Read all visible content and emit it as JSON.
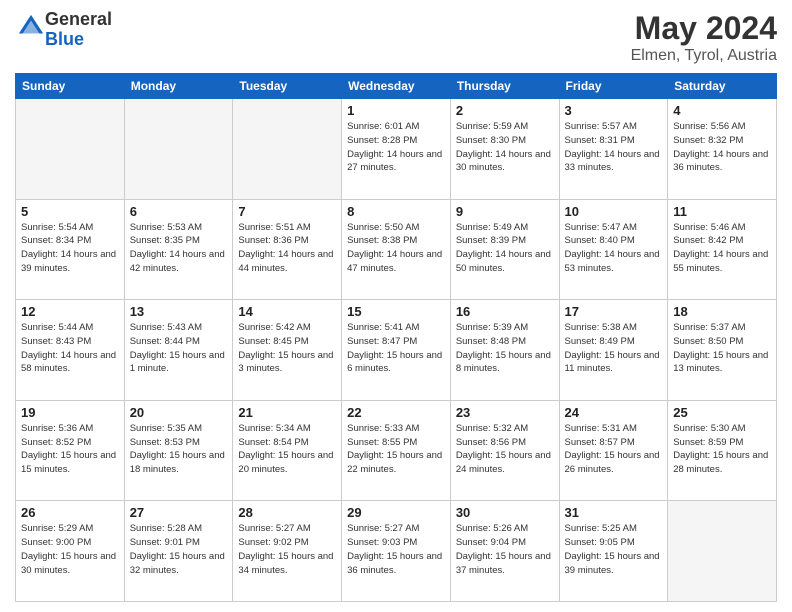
{
  "logo": {
    "general": "General",
    "blue": "Blue"
  },
  "title": "May 2024",
  "subtitle": "Elmen, Tyrol, Austria",
  "days_header": [
    "Sunday",
    "Monday",
    "Tuesday",
    "Wednesday",
    "Thursday",
    "Friday",
    "Saturday"
  ],
  "weeks": [
    [
      {
        "day": "",
        "empty": true
      },
      {
        "day": "",
        "empty": true
      },
      {
        "day": "",
        "empty": true
      },
      {
        "day": "1",
        "sunrise": "Sunrise: 6:01 AM",
        "sunset": "Sunset: 8:28 PM",
        "daylight": "Daylight: 14 hours and 27 minutes."
      },
      {
        "day": "2",
        "sunrise": "Sunrise: 5:59 AM",
        "sunset": "Sunset: 8:30 PM",
        "daylight": "Daylight: 14 hours and 30 minutes."
      },
      {
        "day": "3",
        "sunrise": "Sunrise: 5:57 AM",
        "sunset": "Sunset: 8:31 PM",
        "daylight": "Daylight: 14 hours and 33 minutes."
      },
      {
        "day": "4",
        "sunrise": "Sunrise: 5:56 AM",
        "sunset": "Sunset: 8:32 PM",
        "daylight": "Daylight: 14 hours and 36 minutes."
      }
    ],
    [
      {
        "day": "5",
        "sunrise": "Sunrise: 5:54 AM",
        "sunset": "Sunset: 8:34 PM",
        "daylight": "Daylight: 14 hours and 39 minutes."
      },
      {
        "day": "6",
        "sunrise": "Sunrise: 5:53 AM",
        "sunset": "Sunset: 8:35 PM",
        "daylight": "Daylight: 14 hours and 42 minutes."
      },
      {
        "day": "7",
        "sunrise": "Sunrise: 5:51 AM",
        "sunset": "Sunset: 8:36 PM",
        "daylight": "Daylight: 14 hours and 44 minutes."
      },
      {
        "day": "8",
        "sunrise": "Sunrise: 5:50 AM",
        "sunset": "Sunset: 8:38 PM",
        "daylight": "Daylight: 14 hours and 47 minutes."
      },
      {
        "day": "9",
        "sunrise": "Sunrise: 5:49 AM",
        "sunset": "Sunset: 8:39 PM",
        "daylight": "Daylight: 14 hours and 50 minutes."
      },
      {
        "day": "10",
        "sunrise": "Sunrise: 5:47 AM",
        "sunset": "Sunset: 8:40 PM",
        "daylight": "Daylight: 14 hours and 53 minutes."
      },
      {
        "day": "11",
        "sunrise": "Sunrise: 5:46 AM",
        "sunset": "Sunset: 8:42 PM",
        "daylight": "Daylight: 14 hours and 55 minutes."
      }
    ],
    [
      {
        "day": "12",
        "sunrise": "Sunrise: 5:44 AM",
        "sunset": "Sunset: 8:43 PM",
        "daylight": "Daylight: 14 hours and 58 minutes."
      },
      {
        "day": "13",
        "sunrise": "Sunrise: 5:43 AM",
        "sunset": "Sunset: 8:44 PM",
        "daylight": "Daylight: 15 hours and 1 minute."
      },
      {
        "day": "14",
        "sunrise": "Sunrise: 5:42 AM",
        "sunset": "Sunset: 8:45 PM",
        "daylight": "Daylight: 15 hours and 3 minutes."
      },
      {
        "day": "15",
        "sunrise": "Sunrise: 5:41 AM",
        "sunset": "Sunset: 8:47 PM",
        "daylight": "Daylight: 15 hours and 6 minutes."
      },
      {
        "day": "16",
        "sunrise": "Sunrise: 5:39 AM",
        "sunset": "Sunset: 8:48 PM",
        "daylight": "Daylight: 15 hours and 8 minutes."
      },
      {
        "day": "17",
        "sunrise": "Sunrise: 5:38 AM",
        "sunset": "Sunset: 8:49 PM",
        "daylight": "Daylight: 15 hours and 11 minutes."
      },
      {
        "day": "18",
        "sunrise": "Sunrise: 5:37 AM",
        "sunset": "Sunset: 8:50 PM",
        "daylight": "Daylight: 15 hours and 13 minutes."
      }
    ],
    [
      {
        "day": "19",
        "sunrise": "Sunrise: 5:36 AM",
        "sunset": "Sunset: 8:52 PM",
        "daylight": "Daylight: 15 hours and 15 minutes."
      },
      {
        "day": "20",
        "sunrise": "Sunrise: 5:35 AM",
        "sunset": "Sunset: 8:53 PM",
        "daylight": "Daylight: 15 hours and 18 minutes."
      },
      {
        "day": "21",
        "sunrise": "Sunrise: 5:34 AM",
        "sunset": "Sunset: 8:54 PM",
        "daylight": "Daylight: 15 hours and 20 minutes."
      },
      {
        "day": "22",
        "sunrise": "Sunrise: 5:33 AM",
        "sunset": "Sunset: 8:55 PM",
        "daylight": "Daylight: 15 hours and 22 minutes."
      },
      {
        "day": "23",
        "sunrise": "Sunrise: 5:32 AM",
        "sunset": "Sunset: 8:56 PM",
        "daylight": "Daylight: 15 hours and 24 minutes."
      },
      {
        "day": "24",
        "sunrise": "Sunrise: 5:31 AM",
        "sunset": "Sunset: 8:57 PM",
        "daylight": "Daylight: 15 hours and 26 minutes."
      },
      {
        "day": "25",
        "sunrise": "Sunrise: 5:30 AM",
        "sunset": "Sunset: 8:59 PM",
        "daylight": "Daylight: 15 hours and 28 minutes."
      }
    ],
    [
      {
        "day": "26",
        "sunrise": "Sunrise: 5:29 AM",
        "sunset": "Sunset: 9:00 PM",
        "daylight": "Daylight: 15 hours and 30 minutes."
      },
      {
        "day": "27",
        "sunrise": "Sunrise: 5:28 AM",
        "sunset": "Sunset: 9:01 PM",
        "daylight": "Daylight: 15 hours and 32 minutes."
      },
      {
        "day": "28",
        "sunrise": "Sunrise: 5:27 AM",
        "sunset": "Sunset: 9:02 PM",
        "daylight": "Daylight: 15 hours and 34 minutes."
      },
      {
        "day": "29",
        "sunrise": "Sunrise: 5:27 AM",
        "sunset": "Sunset: 9:03 PM",
        "daylight": "Daylight: 15 hours and 36 minutes."
      },
      {
        "day": "30",
        "sunrise": "Sunrise: 5:26 AM",
        "sunset": "Sunset: 9:04 PM",
        "daylight": "Daylight: 15 hours and 37 minutes."
      },
      {
        "day": "31",
        "sunrise": "Sunrise: 5:25 AM",
        "sunset": "Sunset: 9:05 PM",
        "daylight": "Daylight: 15 hours and 39 minutes."
      },
      {
        "day": "",
        "empty": true
      }
    ]
  ]
}
